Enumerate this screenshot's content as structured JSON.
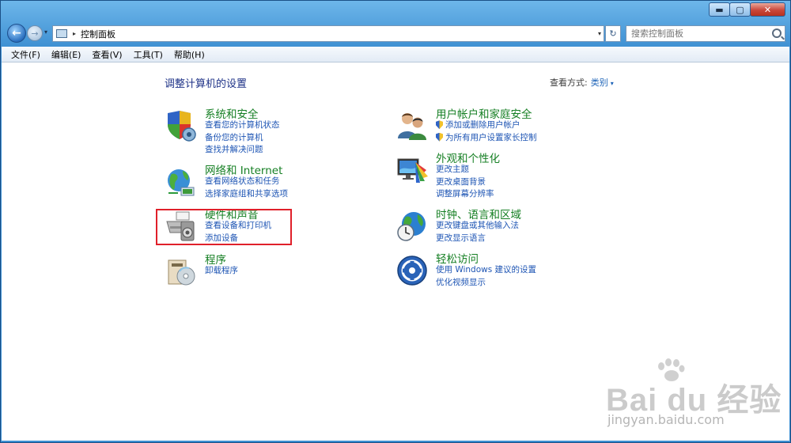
{
  "window": {
    "buttons": {
      "minimize": "▬",
      "maximize": "▢",
      "close": "✕"
    }
  },
  "navbar": {
    "back_arrow": "←",
    "forward_arrow": "→",
    "history_caret": "▾",
    "address_icon": "control-panel-icon",
    "address_separator": "▸",
    "address_path": "控制面板",
    "address_caret": "▾",
    "refresh_glyph": "↻",
    "search_placeholder": "搜索控制面板"
  },
  "menu": {
    "items": [
      "文件(F)",
      "编辑(E)",
      "查看(V)",
      "工具(T)",
      "帮助(H)"
    ]
  },
  "content": {
    "title": "调整计算机的设置",
    "view_label": "查看方式:",
    "view_value": "类别",
    "view_caret": "▾",
    "categories": [
      {
        "icon": "shield-computer-icon",
        "title": "系统和安全",
        "links": [
          "查看您的计算机状态",
          "备份您的计算机",
          "查找并解决问题"
        ]
      },
      {
        "icon": "network-globe-icon",
        "title": "网络和 Internet",
        "links": [
          "查看网络状态和任务",
          "选择家庭组和共享选项"
        ]
      },
      {
        "icon": "printer-speaker-icon",
        "title": "硬件和声音",
        "links": [
          "查看设备和打印机",
          "添加设备"
        ]
      },
      {
        "icon": "programs-disc-icon",
        "title": "程序",
        "links": [
          "卸载程序"
        ]
      },
      {
        "icon": "user-accounts-icon",
        "title": "用户帐户和家庭安全",
        "links": [
          "添加或删除用户帐户",
          "为所有用户设置家长控制"
        ]
      },
      {
        "icon": "appearance-monitor-icon",
        "title": "外观和个性化",
        "links": [
          "更改主题",
          "更改桌面背景",
          "调整屏幕分辨率"
        ]
      },
      {
        "icon": "clock-globe-icon",
        "title": "时钟、语言和区域",
        "links": [
          "更改键盘或其他输入法",
          "更改显示语言"
        ]
      },
      {
        "icon": "ease-of-access-icon",
        "title": "轻松访问",
        "links": [
          "使用 Windows 建议的设置",
          "优化视频显示"
        ]
      }
    ]
  },
  "watermark": {
    "brand": "Bai du 经验",
    "url": "jingyan.baidu.com"
  },
  "colors": {
    "title_blue": "#1e3287",
    "category_green": "#157f23",
    "link_blue": "#1e55b4",
    "highlight_red": "#e0202a"
  }
}
